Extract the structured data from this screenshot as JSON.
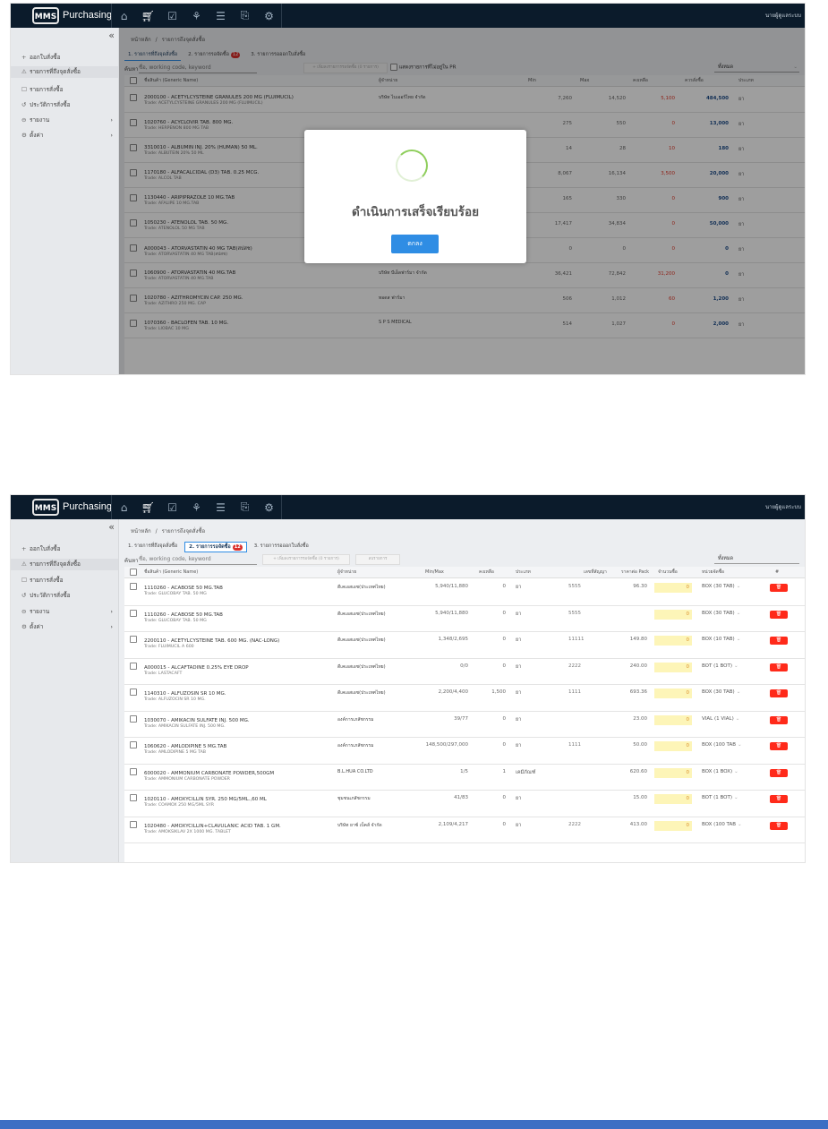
{
  "app": {
    "name": "Purchasing",
    "logo_text": "MMS",
    "user": "นายผู้ดูแลระบบ"
  },
  "nav_icons": [
    "home-icon",
    "cart-icon",
    "checklist-icon",
    "box-icon",
    "document-icon",
    "clipboard-icon",
    "settings-icon"
  ],
  "sidebar": {
    "items": [
      {
        "label": "ออกใบสั่งซื้อ",
        "icon": "+"
      },
      {
        "label": "รายการที่ถึงจุดสั่งซื้อ",
        "icon": "⚠"
      },
      {
        "label": "รายการสั่งซื้อ",
        "icon": "☐"
      },
      {
        "label": "ประวัติการสั่งซื้อ",
        "icon": "↺"
      },
      {
        "label": "รายงาน",
        "icon": "⊖"
      },
      {
        "label": "ตั้งค่า",
        "icon": "⚙"
      }
    ]
  },
  "breadcrumb": {
    "home": "หน้าหลัก",
    "sep": "/",
    "current": "รายการถึงจุดสั่งซื้อ"
  },
  "tabs": [
    {
      "label": "1. รายการที่ถึงจุดสั่งซื้อ"
    },
    {
      "label": "2. รายการรอจัดซื้อ",
      "badge": "12"
    },
    {
      "label": "3. รายการรอออกใบสั่งซื้อ"
    }
  ],
  "search": {
    "label": "ค้นหา",
    "placeholder": "ชื่อ, working code, keyword"
  },
  "screen1": {
    "btn_add": "+ เพิ่มลงรายการรอจัดซื้อ (0 รายการ)",
    "show_not_in_pr": "แสดงรายการที่ไม่อยู่ใน PR",
    "filter": "ทั้งหมด",
    "headers": [
      "ชื่อสินค้า (Generic Name)",
      "ผู้จำหน่าย",
      "Min",
      "Max",
      "คงเหลือ",
      "ควรสั่งซื้อ",
      "ประเภท"
    ],
    "rows": [
      {
        "name": "2000100 - ACETYLCYSTEINE GRANULES 200 MG (FLUIMUCIL)",
        "trade": "Trade: ACETYLCYSTEINE GRANULES 200 MG (FLUIMUCIL)",
        "vendor": "บริษัท ไบเออร์ไทย จำกัด",
        "min": "7,260",
        "max": "14,520",
        "stock": "5,100",
        "order": "484,500",
        "type": "ยา"
      },
      {
        "name": "1020760 - ACYCLOVIR TAB. 800 MG.",
        "trade": "Trade: HERPENON 800 MG TAB",
        "vendor": "",
        "min": "275",
        "max": "550",
        "stock": "0",
        "order": "13,000",
        "type": "ยา"
      },
      {
        "name": "3310010 - ALBUMIN INJ. 20% (HUMAN) 50 ML.",
        "trade": "Trade: ALBUTEIN 20% 50 ML",
        "vendor": "",
        "min": "14",
        "max": "28",
        "stock": "10",
        "order": "180",
        "type": "ยา"
      },
      {
        "name": "1170180 - ALFACALCIDAL (D3) TAB. 0.25 MCG.",
        "trade": "Trade: ALCOL TAB",
        "vendor": "",
        "min": "8,067",
        "max": "16,134",
        "stock": "3,500",
        "order": "20,000",
        "type": "ยา"
      },
      {
        "name": "1130440 - ARIPIPRAZOLE 10 MG.TAB",
        "trade": "Trade: AFALIPE 10 MG.TAB",
        "vendor": "",
        "min": "165",
        "max": "330",
        "stock": "0",
        "order": "900",
        "type": "ยา"
      },
      {
        "name": "1050230 - ATENOLOL TAB. 50 MG.",
        "trade": "Trade: ATENOLOL 50 MG TAB",
        "vendor": "",
        "min": "17,417",
        "max": "34,834",
        "stock": "0",
        "order": "50,000",
        "type": "ยา"
      },
      {
        "name": "A000043 - ATORVASTATIN 40 MG TAB(สปสช)",
        "trade": "Trade: ATORVASTATIN 40 MG TAB(สปสช)",
        "vendor": "สปสช.",
        "min": "0",
        "max": "0",
        "stock": "0",
        "order": "0",
        "type": "ยา"
      },
      {
        "name": "1060900 - ATORVASTATIN 40 MG.TAB",
        "trade": "Trade: ATORVASTATIN 40 MG.TAB",
        "vendor": "บริษัท บีเอ็ลฟาร์มา จำกัด",
        "min": "36,421",
        "max": "72,842",
        "stock": "31,200",
        "order": "0",
        "type": "ยา"
      },
      {
        "name": "1020780 - AZITHROMYCIN CAP. 250 MG.",
        "trade": "Trade: AZITHRO 250 MG. CAP",
        "vendor": "ทอดส ฟาร์มา",
        "min": "506",
        "max": "1,012",
        "stock": "60",
        "order": "1,200",
        "type": "ยา"
      },
      {
        "name": "1070360 - BACLOFEN TAB. 10 MG.",
        "trade": "Trade: LIOBAC 10 MG",
        "vendor": "S P S MEDICAL",
        "min": "514",
        "max": "1,027",
        "stock": "0",
        "order": "2,000",
        "type": "ยา"
      }
    ]
  },
  "modal": {
    "message": "ดำเนินการเสร็จเรียบร้อย",
    "ok": "ตกลง"
  },
  "screen2": {
    "btn_save": "+ เพิ่มลงรายการรอจัดซื้อ (0 รายการ)",
    "btn_delete": "ลบรายการ",
    "filter": "ทั้งหมด",
    "headers": [
      "ชื่อสินค้า (Generic Name)",
      "ผู้จำหน่าย",
      "Min/Max",
      "คงเหลือ",
      "ประเภท",
      "เลขที่สัญญา",
      "ราคาต่อ Pack",
      "จำนวนซื้อ",
      "หน่วยจัดซื้อ",
      "#"
    ],
    "rows": [
      {
        "name": "1110260 - ACABOSE 50 MG.TAB",
        "trade": "Trade: GLUCOBAY TAB. 50 MG",
        "vendor": "ดีเคเอสเอช(ประเทศไทย)",
        "minmax": "5,940/11,880",
        "stock": "0",
        "type": "ยา",
        "contract": "5555",
        "price": "96.30",
        "qty": "0",
        "unit": "BOX (30 TAB)"
      },
      {
        "name": "1110260 - ACABOSE 50 MG.TAB",
        "trade": "Trade: GLUCOBAY TAB. 50 MG",
        "vendor": "ดีเคเอสเอช(ประเทศไทย)",
        "minmax": "5,940/11,880",
        "stock": "0",
        "type": "ยา",
        "contract": "5555",
        "price": "",
        "qty": "0",
        "unit": "BOX (30 TAB)"
      },
      {
        "name": "2200110 - ACETYLCYSTEINE TAB. 600 MG. (NAC-LONG)",
        "trade": "Trade: FLUIMUCIL A 600",
        "vendor": "ดีเคเอสเอช(ประเทศไทย)",
        "minmax": "1,348/2,695",
        "stock": "0",
        "type": "ยา",
        "contract": "11111",
        "price": "149.80",
        "qty": "0",
        "unit": "BOX (10 TAB)"
      },
      {
        "name": "A000015 - ALCAFTADINE 0.25% EYE DROP",
        "trade": "Trade: LASTACAFT",
        "vendor": "ดีเคเอสเอช(ประเทศไทย)",
        "minmax": "0/0",
        "stock": "0",
        "type": "ยา",
        "contract": "2222",
        "price": "240.00",
        "qty": "0",
        "unit": "BOT (1 BOT)"
      },
      {
        "name": "1140310 - ALFUZOSIN SR 10 MG.",
        "trade": "Trade: ALFUZOCIN SR 10 MG.",
        "vendor": "ดีเคเอสเอช(ประเทศไทย)",
        "minmax": "2,200/4,400",
        "stock": "1,500",
        "type": "ยา",
        "contract": "1111",
        "price": "693.36",
        "qty": "0",
        "unit": "BOX (30 TAB)"
      },
      {
        "name": "1030070 - AMIKACIN SULFATE INJ. 500 MG.",
        "trade": "Trade: AMIKACIN SULFATE INJ. 500 MG.",
        "vendor": "องค์การเภสัชกรรม",
        "minmax": "39/77",
        "stock": "0",
        "type": "ยา",
        "contract": "",
        "price": "23.00",
        "qty": "0",
        "unit": "VIAL (1 VIAL)"
      },
      {
        "name": "1060620 - AMLODIPINE 5 MG.TAB",
        "trade": "Trade: AMLODIPINE 5 MG TAB",
        "vendor": "องค์การเภสัชกรรม",
        "minmax": "148,500/297,000",
        "stock": "0",
        "type": "ยา",
        "contract": "1111",
        "price": "50.00",
        "qty": "0",
        "unit": "BOX (100 TAB"
      },
      {
        "name": "6000020 - AMMONIUM CARBONATE POWDER,500GM",
        "trade": "Trade: AMMONIUM CARBONATE POWDER",
        "vendor": "B.L.HUA CO.LTD",
        "minmax": "1/5",
        "stock": "1",
        "type": "เคมีภัณฑ์",
        "contract": "",
        "price": "620.60",
        "qty": "0",
        "unit": "BOX (1 BOX)"
      },
      {
        "name": "1020110 - AMOXYCILLIN SYR. 250 MG/5ML.,60 ML",
        "trade": "Trade: COAMOX 250 MG/5ML SYR",
        "vendor": "ชุมชนเภสัชกรรม",
        "minmax": "41/83",
        "stock": "0",
        "type": "ยา",
        "contract": "",
        "price": "15.00",
        "qty": "0",
        "unit": "BOT (1 BOT)"
      },
      {
        "name": "1020480 - AMOXYCILLIN+CLAVULANIC ACID TAB. 1 GM.",
        "trade": "Trade: AMOKSIKLAV 2X 1000 MG. TABLET",
        "vendor": "บริษัท ยาซ์ เบ็คส์ จำกัด",
        "minmax": "2,109/4,217",
        "stock": "0",
        "type": "ยา",
        "contract": "2222",
        "price": "413.00",
        "qty": "0",
        "unit": "BOX (100 TAB"
      }
    ]
  },
  "colors": {
    "topbar": "#0b1b2b",
    "accent": "#2f8de4",
    "danger": "#ff2a1a",
    "bottom_bar": "#3d6fc4"
  }
}
